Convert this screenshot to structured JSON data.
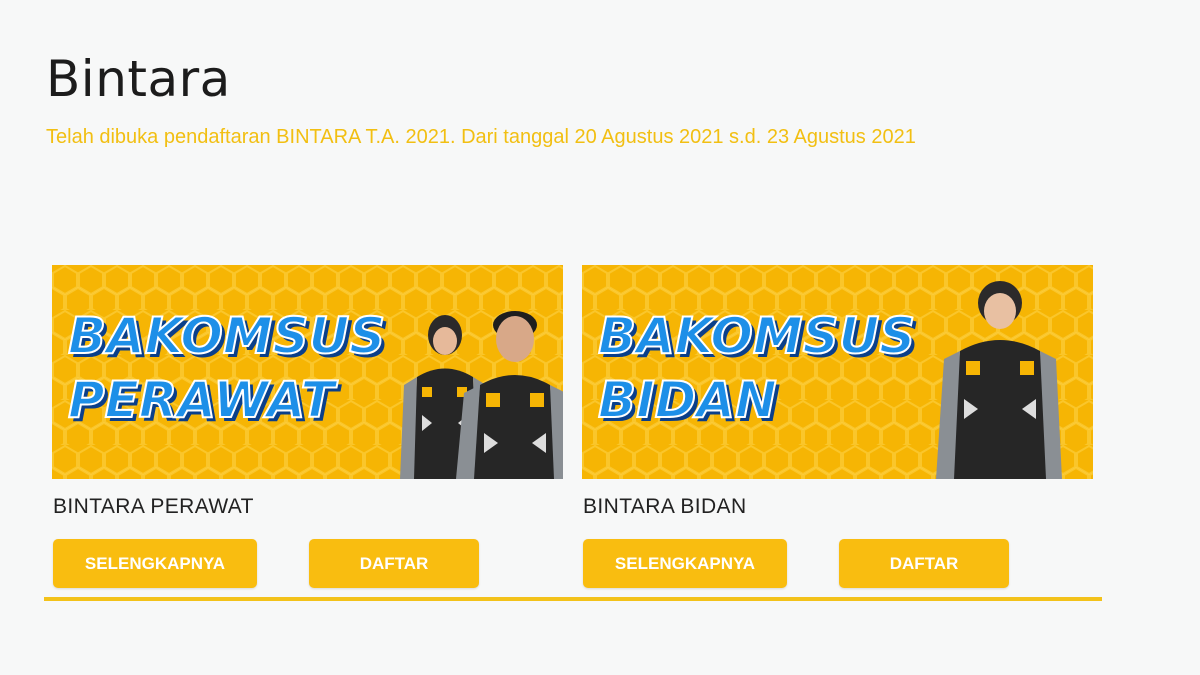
{
  "page": {
    "title": "Bintara",
    "announcement": "Telah dibuka pendaftaran BINTARA T.A. 2021. Dari tanggal 20 Agustus 2021 s.d. 23 Agustus 2021"
  },
  "cards": [
    {
      "banner_line1": "BAKOMSUS",
      "banner_line2": "PERAWAT",
      "title": "BINTARA PERAWAT",
      "more_label": "SELENGKAPNYA",
      "register_label": "DAFTAR"
    },
    {
      "banner_line1": "BAKOMSUS",
      "banner_line2": "BIDAN",
      "title": "BINTARA BIDAN",
      "more_label": "SELENGKAPNYA",
      "register_label": "DAFTAR"
    }
  ],
  "colors": {
    "accent": "#f9bd10",
    "announcement": "#f2bf12",
    "banner_bg": "#f6b504",
    "banner_text": "#1d8fe8"
  }
}
